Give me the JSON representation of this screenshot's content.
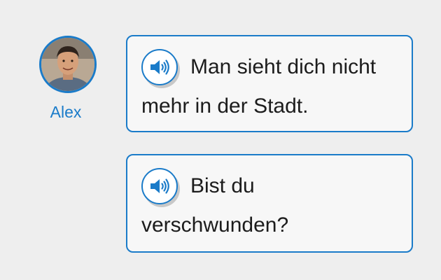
{
  "speaker": {
    "name": "Alex"
  },
  "messages": [
    {
      "text": "Man sieht dich nicht mehr in der Stadt."
    },
    {
      "text": "Bist du verschwunden?"
    }
  ],
  "colors": {
    "accent": "#1a7bc9",
    "background": "#eeeeee",
    "bubble": "#f7f7f7"
  },
  "icons": [
    "speaker-icon"
  ]
}
